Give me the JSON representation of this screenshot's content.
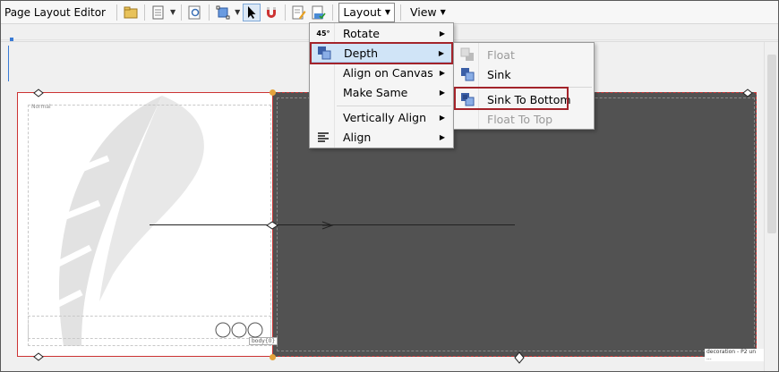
{
  "toolbar": {
    "title": "Page Layout Editor",
    "menus": [
      {
        "label": "Layout",
        "open": true
      },
      {
        "label": "View",
        "open": false
      }
    ]
  },
  "layout_menu": {
    "items": [
      {
        "label": "Rotate",
        "icon": "rotate-icon",
        "icon_text": "45°",
        "submenu": true
      },
      {
        "label": "Depth",
        "icon": "depth-icon",
        "submenu": true,
        "highlighted": true
      },
      {
        "label": "Align on Canvas",
        "submenu": true
      },
      {
        "label": "Make Same",
        "submenu": true
      },
      {
        "label": "Vertically Align",
        "submenu": true
      },
      {
        "label": "Align",
        "icon": "align-left-icon",
        "submenu": true
      }
    ]
  },
  "depth_submenu": {
    "items": [
      {
        "label": "Float",
        "icon": "float-icon",
        "disabled": true
      },
      {
        "label": "Sink",
        "icon": "sink-icon",
        "disabled": false
      },
      {
        "label": "Sink To Bottom",
        "icon": "sink-to-bottom-icon",
        "disabled": false,
        "highlighted": true
      },
      {
        "label": "Float To Top",
        "icon": "float-to-top-icon",
        "disabled": true
      }
    ]
  },
  "canvas": {
    "normal_label": "Normal",
    "body_label": "body{0}",
    "decoration_label": "decoration - P2 un ..."
  },
  "colors": {
    "highlight_box": "#a3232a",
    "selection": "#d0e4f7",
    "dark_panel": "#525252"
  }
}
